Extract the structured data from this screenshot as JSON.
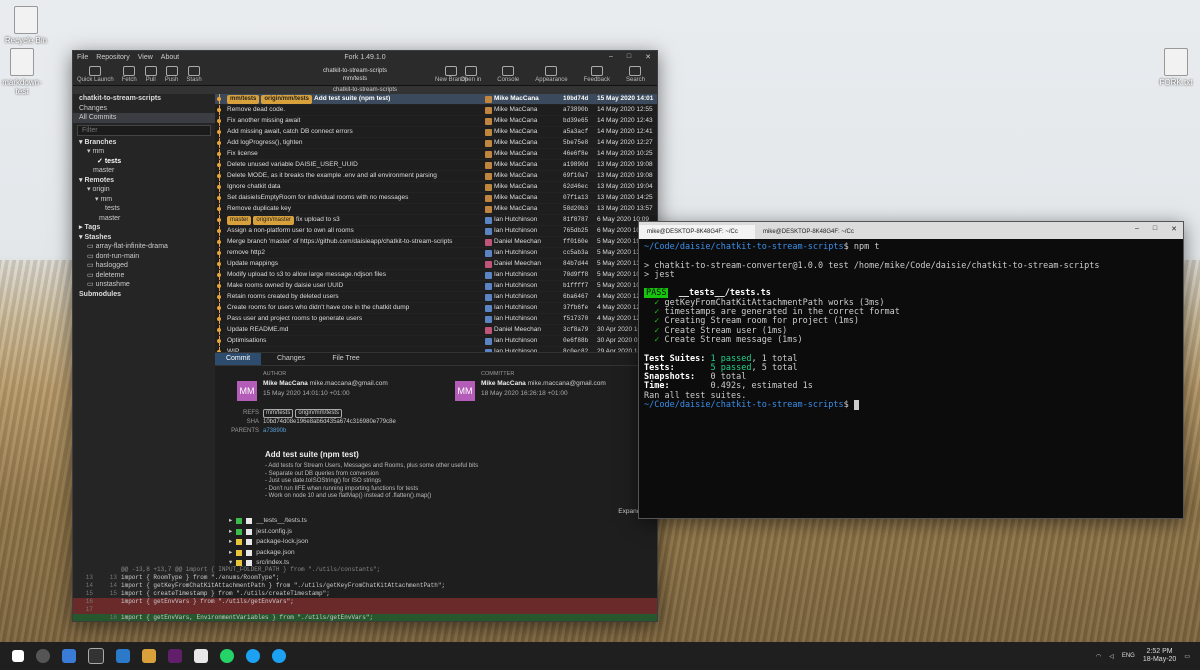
{
  "desktop": {
    "icons": [
      {
        "label": "Recycle Bin"
      },
      {
        "label": "markdown-test"
      },
      {
        "label": "FORK.txt"
      }
    ]
  },
  "fork": {
    "title": "Fork 1.49.1.0",
    "menu": [
      "File",
      "Repository",
      "View",
      "About"
    ],
    "toolbar_left": [
      "Quick Launch",
      "Fetch",
      "Pull",
      "Push",
      "Stash"
    ],
    "repo_name": "chatkit-to-stream-scripts",
    "repo_branch": "mm/tests",
    "new_branch": "New Branch",
    "toolbar_right": [
      "Open in",
      "Console",
      "Appearance",
      "Feedback",
      "Search"
    ],
    "tab_label": "chatkit-to-stream-scripts",
    "sidebar": {
      "repo": "chatkit-to-stream-scripts",
      "changes": "Changes",
      "all_commits": "All Commits",
      "filter_placeholder": "Filter",
      "branches": "Branches",
      "mm": "mm",
      "tests": "tests",
      "master": "master",
      "remotes": "Remotes",
      "origin": "origin",
      "r_mm": "mm",
      "r_tests": "tests",
      "r_master": "master",
      "tags": "Tags",
      "stashes": "Stashes",
      "stash_items": [
        "array-flat-infinite-drama",
        "dont-run-main",
        "haslogged",
        "deleteme",
        "unstashme"
      ],
      "submodules": "Submodules"
    },
    "commits": [
      {
        "refs": [
          "mm/tests",
          "origin/mm/tests"
        ],
        "msg": "Add test suite (npm test)",
        "author": "Mike MacCana",
        "sha": "10bd74d",
        "date": "15 May 2020 14:01",
        "av": "o"
      },
      {
        "refs": [],
        "msg": "Remove dead code.",
        "author": "Mike MacCana",
        "sha": "a73890b",
        "date": "14 May 2020 12:55",
        "av": "o"
      },
      {
        "refs": [],
        "msg": "Fix another missing await",
        "author": "Mike MacCana",
        "sha": "bd39e65",
        "date": "14 May 2020 12:43",
        "av": "o"
      },
      {
        "refs": [],
        "msg": "Add missing await, catch DB connect errors",
        "author": "Mike MacCana",
        "sha": "a5a3acf",
        "date": "14 May 2020 12:41",
        "av": "o"
      },
      {
        "refs": [],
        "msg": "Add logProgress(), tighten",
        "author": "Mike MacCana",
        "sha": "5be75e8",
        "date": "14 May 2020 12:27",
        "av": "o"
      },
      {
        "refs": [],
        "msg": "Fix license",
        "author": "Mike MacCana",
        "sha": "46e6f8e",
        "date": "14 May 2020 10:25",
        "av": "o"
      },
      {
        "refs": [],
        "msg": "Delete unused variable DAISIE_USER_UUID",
        "author": "Mike MacCana",
        "sha": "a19890d",
        "date": "13 May 2020 19:08",
        "av": "o"
      },
      {
        "refs": [],
        "msg": "Delete MODE, as it breaks the example .env and all environment parsing",
        "author": "Mike MacCana",
        "sha": "69f10a7",
        "date": "13 May 2020 19:08",
        "av": "o"
      },
      {
        "refs": [],
        "msg": "Ignore chatkit data",
        "author": "Mike MacCana",
        "sha": "62d46ec",
        "date": "13 May 2020 19:04",
        "av": "o"
      },
      {
        "refs": [],
        "msg": "Set daisieIsEmptyRoom for individual rooms with no messages",
        "author": "Mike MacCana",
        "sha": "07f1a13",
        "date": "13 May 2020 14:25",
        "av": "o"
      },
      {
        "refs": [],
        "msg": "Remove duplicate key",
        "author": "Mike MacCana",
        "sha": "58d20b3",
        "date": "13 May 2020 13:57",
        "av": "o"
      },
      {
        "refs": [
          "master",
          "origin/master"
        ],
        "msg": "fix upload to s3",
        "author": "Ian Hutchinson",
        "sha": "81f8787",
        "date": "6 May 2020 10:09",
        "av": "b"
      },
      {
        "refs": [],
        "msg": "Assign a non-platform user to own all rooms",
        "author": "Ian Hutchinson",
        "sha": "765db25",
        "date": "6 May 2020 10:07",
        "av": "b"
      },
      {
        "refs": [],
        "msg": "Merge branch 'master' of https://github.com/daisieapp/chatkit-to-stream-scripts",
        "author": "Daniel Meechan",
        "sha": "ff0160e",
        "date": "5 May 2020 19:04",
        "av": "p"
      },
      {
        "refs": [],
        "msg": "remove http2",
        "author": "Ian Hutchinson",
        "sha": "cc5ab3a",
        "date": "5 May 2020 13:48",
        "av": "b"
      },
      {
        "refs": [],
        "msg": "Update mappings",
        "author": "Daniel Meechan",
        "sha": "84b7d44",
        "date": "5 May 2020 13:44",
        "av": "p"
      },
      {
        "refs": [],
        "msg": "Modify upload to s3 to allow large message.ndjson files",
        "author": "Ian Hutchinson",
        "sha": "70d9ff8",
        "date": "5 May 2020 10:45",
        "av": "b"
      },
      {
        "refs": [],
        "msg": "Make rooms owned by daisie user UUID",
        "author": "Ian Hutchinson",
        "sha": "b1ffff7",
        "date": "5 May 2020 10:40",
        "av": "b"
      },
      {
        "refs": [],
        "msg": "Retain rooms created by deleted users",
        "author": "Ian Hutchinson",
        "sha": "6ba6467",
        "date": "4 May 2020 12:11",
        "av": "b"
      },
      {
        "refs": [],
        "msg": "Create rooms for users who didn't have one in the chatkit dump",
        "author": "Ian Hutchinson",
        "sha": "37fb6fe",
        "date": "4 May 2020 12:08",
        "av": "b"
      },
      {
        "refs": [],
        "msg": "Pass user and project rooms to generate users",
        "author": "Ian Hutchinson",
        "sha": "f517370",
        "date": "4 May 2020 12:08",
        "av": "b"
      },
      {
        "refs": [],
        "msg": "Update README.md",
        "author": "Daniel Meechan",
        "sha": "3cf8a79",
        "date": "30 Apr 2020 16:57",
        "av": "p"
      },
      {
        "refs": [],
        "msg": "Optimisations",
        "author": "Ian Hutchinson",
        "sha": "0e6f88b",
        "date": "30 Apr 2020 02:45",
        "av": "b"
      },
      {
        "refs": [],
        "msg": "WIP",
        "author": "Ian Hutchinson",
        "sha": "8c0ec82",
        "date": "29 Apr 2020 18:03",
        "av": "b"
      },
      {
        "refs": [],
        "msg": "WIP",
        "author": "Ian Hutchinson",
        "sha": "90e5379",
        "date": "29 Apr 2020 18:02",
        "av": "b"
      }
    ],
    "details": {
      "tabs": [
        "Commit",
        "Changes",
        "File Tree"
      ],
      "author_label": "AUTHOR",
      "committer_label": "COMMITTER",
      "initials": "MM",
      "author_name": "Mike MacCana",
      "author_email": "mike.maccana@gmail.com",
      "author_date": "15 May 2020 14:01:10 +01:00",
      "committer_name": "Mike MacCana",
      "committer_email": "mike.maccana@gmail.com",
      "committer_date": "18 May 2020 16:26:18 +01:00",
      "refs_label": "REFS",
      "refs": [
        "mm/tests",
        "origin/mm/tests"
      ],
      "sha_label": "SHA",
      "sha": "10bd74d08e196e8ab6d435a674c316980e779c8e",
      "parents_label": "PARENTS",
      "parents": "a73890b",
      "subject": "Add test suite (npm test)",
      "body": [
        "- Add tests for Stream Users, Messages and Rooms, plus some other useful bits",
        "- Separate out DB queries from conversion",
        "- Just use date.toISOString() for ISO strings",
        "- Don't run IIFE when running importing functions for tests",
        "- Work on node 10 and use flatMap() instead of .flatten().map()"
      ],
      "expand_all": "Expand All",
      "files": [
        "__tests__/tests.ts",
        "jest.config.js",
        "package-lock.json",
        "package.json",
        "src/index.ts"
      ]
    },
    "diff": [
      {
        "a": "",
        "b": "",
        "t": "@@ -13,8 +13,7 @@ import { INPUT_FOLDER_PATH } from \"./utils/constants\";",
        "k": "hunk"
      },
      {
        "a": "13",
        "b": "13",
        "t": "import { RoomType } from \"./enums/RoomType\";",
        "k": ""
      },
      {
        "a": "14",
        "b": "14",
        "t": "import { getKeyFromChatKitAttachmentPath } from \"./utils/getKeyFromChatKitAttachmentPath\";",
        "k": ""
      },
      {
        "a": "15",
        "b": "15",
        "t": "import { createTimestamp } from \"./utils/createTimestamp\";",
        "k": ""
      },
      {
        "a": "16",
        "b": "",
        "t": "import { getEnvVars } from \"./utils/getEnvVars\";",
        "k": "del"
      },
      {
        "a": "17",
        "b": "",
        "t": "",
        "k": "del"
      },
      {
        "a": "",
        "b": "16",
        "t": "import { getEnvVars, EnvironmentVariables } from \"./utils/getEnvVars\";",
        "k": "add"
      }
    ]
  },
  "terminal": {
    "tabs": [
      "mike@DESKTOP-8K48G4F: ~/Cc",
      "mike@DESKTOP-8K48G4F: ~/Cc"
    ],
    "prompt_path": "~/Code/daisie/chatkit-to-stream-scripts",
    "cmd": "npm t",
    "line1": "> chatkit-to-stream-converter@1.0.0 test /home/mike/Code/daisie/chatkit-to-stream-scripts",
    "line2": "> jest",
    "pass": "PASS",
    "file": "__tests__/tests.ts",
    "tests": [
      "getKeyFromChatKitAttachmentPath works (3ms)",
      "timestamps are generated in the correct format",
      "Creating Stream room for project (1ms)",
      "Create Stream user (1ms)",
      "Create Stream message (1ms)"
    ],
    "suites_label": "Test Suites:",
    "suites_passed": "1 passed",
    "suites_total": ", 1 total",
    "tests_label": "Tests:",
    "tests_passed": "5 passed",
    "tests_total": ", 5 total",
    "snap_label": "Snapshots:",
    "snap_val": "0 total",
    "time_label": "Time:",
    "time_val": "0.492s, estimated 1s",
    "ran": "Ran all test suites."
  },
  "taskbar": {
    "lang": "ENG",
    "time": "2:52 PM",
    "date": "18-May-20"
  }
}
